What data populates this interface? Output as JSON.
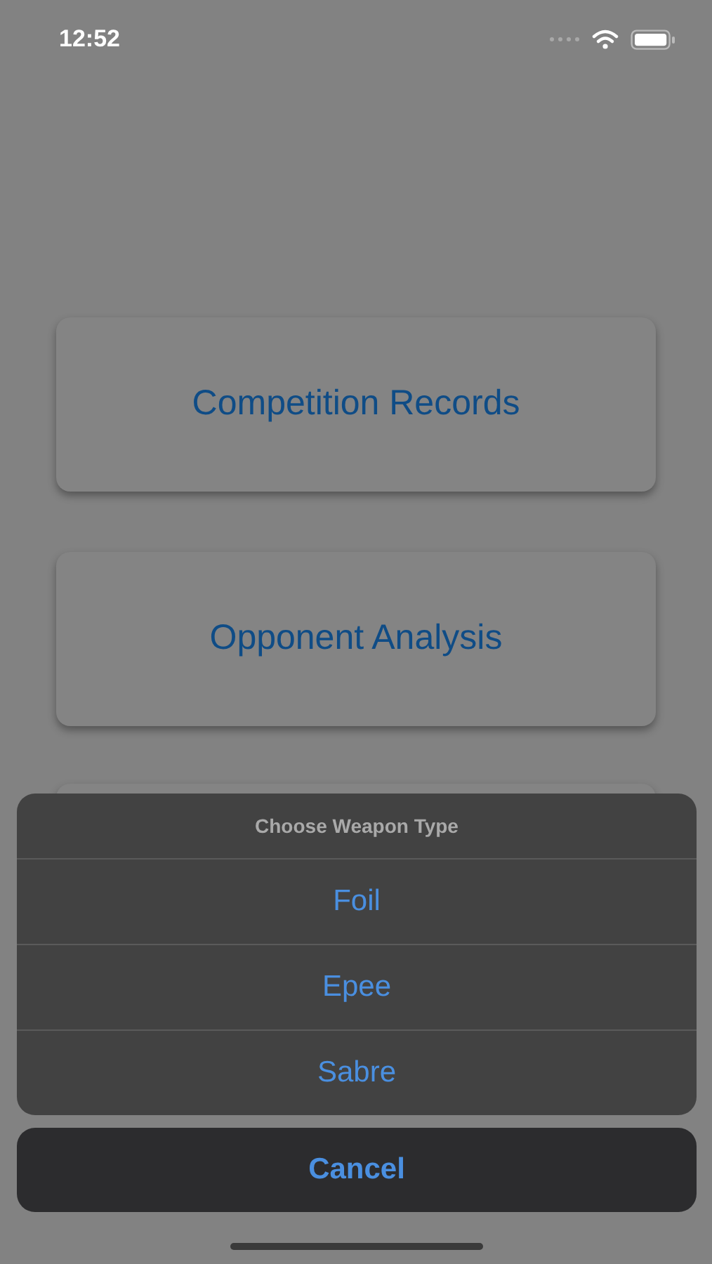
{
  "status_bar": {
    "time": "12:52"
  },
  "menu_buttons": [
    {
      "label": "Competition Records"
    },
    {
      "label": "Opponent Analysis"
    }
  ],
  "action_sheet": {
    "title": "Choose Weapon Type",
    "options": [
      {
        "label": "Foil"
      },
      {
        "label": "Epee"
      },
      {
        "label": "Sabre"
      }
    ],
    "cancel": "Cancel"
  }
}
